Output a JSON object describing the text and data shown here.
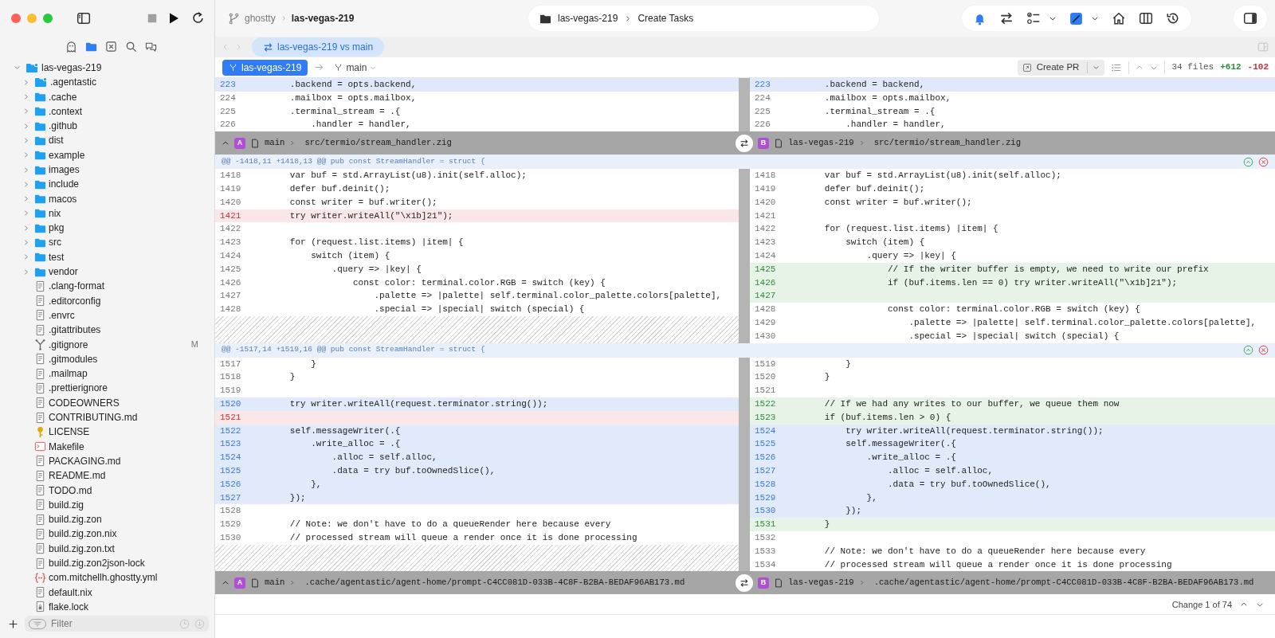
{
  "window": {
    "breadcrumb": {
      "repo": "ghostty",
      "branch": "las-vegas-219"
    },
    "location": {
      "folder": "las-vegas-219",
      "task": "Create Tasks"
    }
  },
  "sidebar": {
    "views": [
      {
        "kind": "agents",
        "selected": false
      },
      {
        "kind": "files",
        "selected": true
      },
      {
        "kind": "tasks",
        "selected": false
      },
      {
        "kind": "search",
        "selected": false
      },
      {
        "kind": "chat",
        "selected": false
      }
    ],
    "tree": {
      "label": "las-vegas-219",
      "kind": "repo-folder",
      "expanded": true,
      "children": [
        {
          "label": ".agentastic",
          "kind": "config-folder",
          "expanded": false
        },
        {
          "label": ".cache",
          "kind": "folder",
          "expanded": false
        },
        {
          "label": ".context",
          "kind": "folder",
          "expanded": false
        },
        {
          "label": ".github",
          "kind": "folder",
          "expanded": false
        },
        {
          "label": "dist",
          "kind": "folder",
          "expanded": false
        },
        {
          "label": "example",
          "kind": "folder",
          "expanded": false
        },
        {
          "label": "images",
          "kind": "folder",
          "expanded": false
        },
        {
          "label": "include",
          "kind": "folder",
          "expanded": false
        },
        {
          "label": "macos",
          "kind": "folder",
          "expanded": false
        },
        {
          "label": "nix",
          "kind": "folder",
          "expanded": false
        },
        {
          "label": "pkg",
          "kind": "folder",
          "expanded": false
        },
        {
          "label": "src",
          "kind": "folder",
          "expanded": false
        },
        {
          "label": "test",
          "kind": "folder",
          "expanded": false
        },
        {
          "label": "vendor",
          "kind": "folder",
          "expanded": false
        },
        {
          "label": ".clang-format",
          "kind": "doc"
        },
        {
          "label": ".editorconfig",
          "kind": "doc"
        },
        {
          "label": ".envrc",
          "kind": "doc"
        },
        {
          "label": ".gitattributes",
          "kind": "doc"
        },
        {
          "label": ".gitignore",
          "kind": "git",
          "badge": "M"
        },
        {
          "label": ".gitmodules",
          "kind": "doc"
        },
        {
          "label": ".mailmap",
          "kind": "doc"
        },
        {
          "label": ".prettierignore",
          "kind": "doc"
        },
        {
          "label": "CODEOWNERS",
          "kind": "doc"
        },
        {
          "label": "CONTRIBUTING.md",
          "kind": "doc"
        },
        {
          "label": "LICENSE",
          "kind": "license"
        },
        {
          "label": "Makefile",
          "kind": "makefile"
        },
        {
          "label": "PACKAGING.md",
          "kind": "doc"
        },
        {
          "label": "README.md",
          "kind": "doc"
        },
        {
          "label": "TODO.md",
          "kind": "doc"
        },
        {
          "label": "build.zig",
          "kind": "doc"
        },
        {
          "label": "build.zig.zon",
          "kind": "doc"
        },
        {
          "label": "build.zig.zon.nix",
          "kind": "doc"
        },
        {
          "label": "build.zig.zon.txt",
          "kind": "doc"
        },
        {
          "label": "build.zig.zon2json-lock",
          "kind": "doc"
        },
        {
          "label": "com.mitchellh.ghostty.yml",
          "kind": "yaml"
        },
        {
          "label": "default.nix",
          "kind": "doc"
        },
        {
          "label": "flake.lock",
          "kind": "lock"
        }
      ]
    },
    "filter": {
      "placeholder": "Filter"
    }
  },
  "tabs": [
    {
      "label": "las-vegas-219 vs main",
      "selected": true
    }
  ],
  "compare": {
    "source": "las-vegas-219",
    "target": "main",
    "action": "Create PR",
    "files": "34 files",
    "added": "+612",
    "removed": "-102"
  },
  "diff": {
    "sections": [
      {
        "kind": "lines",
        "left": [
          {
            "num": "223",
            "code": "        .backend = opts.backend,",
            "kind": "selected"
          },
          {
            "num": "224",
            "code": "        .mailbox = opts.mailbox,",
            "kind": "context"
          },
          {
            "num": "225",
            "code": "        .terminal_stream = .{",
            "kind": "context"
          },
          {
            "num": "226",
            "code": "            .handler = handler,",
            "kind": "context"
          }
        ],
        "right": [
          {
            "num": "223",
            "code": "        .backend = backend,",
            "kind": "selected"
          },
          {
            "num": "224",
            "code": "        .mailbox = opts.mailbox,",
            "kind": "context"
          },
          {
            "num": "225",
            "code": "        .terminal_stream = .{",
            "kind": "context"
          },
          {
            "num": "226",
            "code": "            .handler = handler,",
            "kind": "context"
          }
        ]
      },
      {
        "kind": "file",
        "expanded": true,
        "left": {
          "side": "A",
          "branch": "main",
          "path": "src/termio/stream_handler.zig"
        },
        "right": {
          "side": "B",
          "branch": "las-vegas-219",
          "path": "src/termio/stream_handler.zig"
        }
      },
      {
        "kind": "hunk",
        "header": "@@ -1418,11 +1418,13 @@ pub const StreamHandler = struct {",
        "left": [
          {
            "num": "1418",
            "code": "        var buf = std.ArrayList(u8).init(self.alloc);",
            "kind": "context"
          },
          {
            "num": "1419",
            "code": "        defer buf.deinit();",
            "kind": "context"
          },
          {
            "num": "1420",
            "code": "        const writer = buf.writer();",
            "kind": "context"
          },
          {
            "num": "1421",
            "code": "        try writer.writeAll(\"\\x1b]21\");",
            "kind": "removed"
          },
          {
            "num": "1422",
            "kind": "context"
          },
          {
            "num": "1423",
            "code": "        for (request.list.items) |item| {",
            "kind": "context"
          },
          {
            "num": "1424",
            "code": "            switch (item) {",
            "kind": "context"
          },
          {
            "num": "1425",
            "code": "                .query => |key| {",
            "kind": "context"
          },
          {
            "num": "1426",
            "code": "                    const color: terminal.color.RGB = switch (key) {",
            "kind": "context"
          },
          {
            "num": "1427",
            "code": "                        .palette => |palette| self.terminal.color_palette.colors[palette],",
            "kind": "context"
          },
          {
            "num": "1428",
            "code": "                        .special => |special| switch (special) {",
            "kind": "context"
          },
          {
            "kind": "filler"
          },
          {
            "kind": "filler"
          }
        ],
        "right": [
          {
            "num": "1418",
            "code": "        var buf = std.ArrayList(u8).init(self.alloc);",
            "kind": "context"
          },
          {
            "num": "1419",
            "code": "        defer buf.deinit();",
            "kind": "context"
          },
          {
            "num": "1420",
            "code": "        const writer = buf.writer();",
            "kind": "context"
          },
          {
            "num": "1421",
            "kind": "context"
          },
          {
            "num": "1422",
            "code": "        for (request.list.items) |item| {",
            "kind": "context"
          },
          {
            "num": "1423",
            "code": "            switch (item) {",
            "kind": "context"
          },
          {
            "num": "1424",
            "code": "                .query => |key| {",
            "kind": "context"
          },
          {
            "num": "1425",
            "code": "                    // If the writer buffer is empty, we need to write our prefix",
            "kind": "added"
          },
          {
            "num": "1426",
            "code": "                    if (buf.items.len == 0) try writer.writeAll(\"\\x1b]21\");",
            "kind": "added"
          },
          {
            "num": "1427",
            "kind": "added"
          },
          {
            "num": "1428",
            "code": "                    const color: terminal.color.RGB = switch (key) {",
            "kind": "context"
          },
          {
            "num": "1429",
            "code": "                        .palette => |palette| self.terminal.color_palette.colors[palette],",
            "kind": "context"
          },
          {
            "num": "1430",
            "code": "                        .special => |special| switch (special) {",
            "kind": "context"
          }
        ]
      },
      {
        "kind": "hunk",
        "header": "@@ -1517,14 +1519,16 @@ pub const StreamHandler = struct {",
        "left": [
          {
            "num": "1517",
            "code": "            }",
            "kind": "context"
          },
          {
            "num": "1518",
            "code": "        }",
            "kind": "context"
          },
          {
            "num": "1519",
            "kind": "context"
          },
          {
            "num": "1520",
            "code": "        try writer.writeAll(request.terminator.string());",
            "kind": "moved"
          },
          {
            "num": "1521",
            "kind": "removed"
          },
          {
            "num": "1522",
            "code": "        self.messageWriter(.{",
            "kind": "moved"
          },
          {
            "num": "1523",
            "code": "            .write_alloc = .{",
            "kind": "moved"
          },
          {
            "num": "1524",
            "code": "                .alloc = self.alloc,",
            "kind": "moved"
          },
          {
            "num": "1525",
            "code": "                .data = try buf.toOwnedSlice(),",
            "kind": "moved"
          },
          {
            "num": "1526",
            "code": "            },",
            "kind": "moved"
          },
          {
            "num": "1527",
            "code": "        });",
            "kind": "moved"
          },
          {
            "num": "1528",
            "kind": "context"
          },
          {
            "num": "1529",
            "code": "        // Note: we don't have to do a queueRender here because every",
            "kind": "context"
          },
          {
            "num": "1530",
            "code": "        // processed stream will queue a render once it is done processing",
            "kind": "context"
          },
          {
            "kind": "filler"
          },
          {
            "kind": "filler"
          }
        ],
        "right": [
          {
            "num": "1519",
            "code": "            }",
            "kind": "context"
          },
          {
            "num": "1520",
            "code": "        }",
            "kind": "context"
          },
          {
            "num": "1521",
            "kind": "context"
          },
          {
            "num": "1522",
            "code": "        // If we had any writes to our buffer, we queue them now",
            "kind": "added"
          },
          {
            "num": "1523",
            "code": "        if (buf.items.len > 0) {",
            "kind": "added"
          },
          {
            "num": "1524",
            "code": "            try writer.writeAll(request.terminator.string());",
            "kind": "moved"
          },
          {
            "num": "1525",
            "code": "            self.messageWriter(.{",
            "kind": "moved"
          },
          {
            "num": "1526",
            "code": "                .write_alloc = .{",
            "kind": "moved"
          },
          {
            "num": "1527",
            "code": "                    .alloc = self.alloc,",
            "kind": "moved"
          },
          {
            "num": "1528",
            "code": "                    .data = try buf.toOwnedSlice(),",
            "kind": "moved"
          },
          {
            "num": "1529",
            "code": "                },",
            "kind": "moved"
          },
          {
            "num": "1530",
            "code": "            });",
            "kind": "moved"
          },
          {
            "num": "1531",
            "code": "        }",
            "kind": "added"
          },
          {
            "num": "1532",
            "kind": "context"
          },
          {
            "num": "1533",
            "code": "        // Note: we don't have to do a queueRender here because every",
            "kind": "context"
          },
          {
            "num": "1534",
            "code": "        // processed stream will queue a render once it is done processing",
            "kind": "context"
          }
        ]
      },
      {
        "kind": "file",
        "expanded": true,
        "left": {
          "side": "A",
          "branch": "main",
          "path": ".cache/agentastic/agent-home/prompt-C4CC081D-033B-4C8F-B2BA-BEDAF96AB173.md"
        },
        "right": {
          "side": "B",
          "branch": "las-vegas-219",
          "path": ".cache/agentastic/agent-home/prompt-C4CC081D-033B-4C8F-B2BA-BEDAF96AB173.md"
        }
      }
    ]
  },
  "status_bar": {
    "change": "Change 1 of 74"
  }
}
